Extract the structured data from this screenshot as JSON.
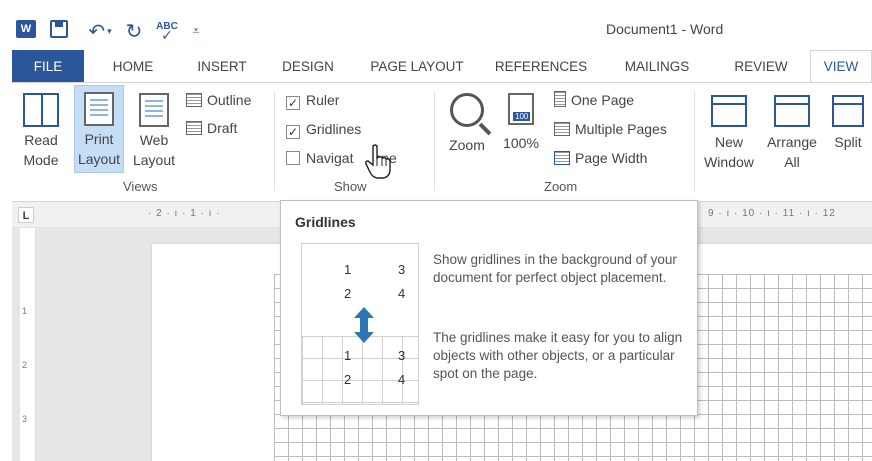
{
  "app": {
    "title": "Document1 - Word",
    "word_logo_letter": "W",
    "spell_check_text": "ABC"
  },
  "tabs": [
    "FILE",
    "HOME",
    "INSERT",
    "DESIGN",
    "PAGE LAYOUT",
    "REFERENCES",
    "MAILINGS",
    "REVIEW",
    "VIEW"
  ],
  "active_tab": "VIEW",
  "ribbon": {
    "views": {
      "read_mode_line1": "Read",
      "read_mode_line2": "Mode",
      "print_layout_line1": "Print",
      "print_layout_line2": "Layout",
      "web_layout_line1": "Web",
      "web_layout_line2": "Layout",
      "outline": "Outline",
      "draft": "Draft",
      "group_label": "Views"
    },
    "show": {
      "ruler": "Ruler",
      "ruler_checked": true,
      "gridlines": "Gridlines",
      "gridlines_checked": true,
      "navigation_pane_start": "Navigat",
      "navigation_pane_end": "ane",
      "navigation_checked": false,
      "group_label": "Show"
    },
    "zoom": {
      "zoom": "Zoom",
      "hundred": "100%",
      "hundred_icon_text": "100",
      "one_page": "One Page",
      "multiple_pages": "Multiple Pages",
      "page_width": "Page Width",
      "group_label": "Zoom"
    },
    "window": {
      "new_window_line1": "New",
      "new_window_line2": "Window",
      "arrange_all_line1": "Arrange",
      "arrange_all_line2": "All",
      "split": "Split"
    }
  },
  "ruler": {
    "left_marks": "· 2 · ı · 1 · ı ·",
    "right_marks": "9 · ı · 10 · ı · 11 · ı · 12",
    "corner_glyph": "L",
    "vertical_marks": [
      "1",
      "2",
      "3"
    ]
  },
  "tooltip": {
    "title": "Gridlines",
    "illustration_numbers": {
      "top_left_1": "1",
      "top_right_1": "3",
      "top_left_2": "2",
      "top_right_2": "4",
      "bottom_left_1": "1",
      "bottom_right_1": "3",
      "bottom_left_2": "2",
      "bottom_right_2": "4"
    },
    "paragraph1": "Show gridlines in the background of your document for perfect object placement.",
    "paragraph2": "The gridlines make it easy for you to align objects with other objects, or a particular spot on the page."
  },
  "colors": {
    "accent": "#2b579a",
    "selected_button": "#c5ddf5",
    "arrow": "#2e75b6"
  }
}
